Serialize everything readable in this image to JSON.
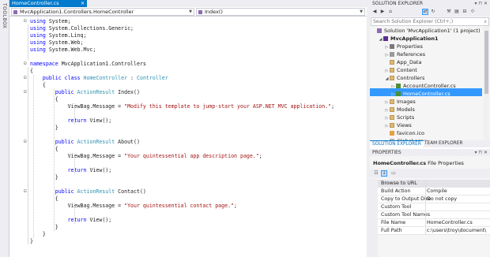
{
  "toolbox": {
    "label": "TOOLBOX"
  },
  "editor": {
    "tab_title": "HomeController.cs",
    "tab_close": "✕",
    "nav_class": "MvcApplication1.Controllers.HomeController",
    "nav_member": "Index()"
  },
  "code": {
    "lines": [
      [
        [
          "using ",
          "kw"
        ],
        [
          "System;",
          ""
        ]
      ],
      [
        [
          "using ",
          "kw"
        ],
        [
          "System.Collections.Generic;",
          ""
        ]
      ],
      [
        [
          "using ",
          "kw"
        ],
        [
          "System.Linq;",
          ""
        ]
      ],
      [
        [
          "using ",
          "kw"
        ],
        [
          "System.Web;",
          ""
        ]
      ],
      [
        [
          "using ",
          "kw"
        ],
        [
          "System.Web.Mvc;",
          ""
        ]
      ],
      [],
      [
        [
          "namespace ",
          "kw"
        ],
        [
          "MvcApplication1.Controllers",
          ""
        ]
      ],
      [
        [
          "{",
          ""
        ]
      ],
      [
        [
          "    public class ",
          "kw"
        ],
        [
          "HomeController",
          "ty"
        ],
        [
          " : ",
          ""
        ],
        [
          "Controller",
          "ty"
        ]
      ],
      [
        [
          "    {",
          ""
        ]
      ],
      [
        [
          "        public ",
          "kw"
        ],
        [
          "ActionResult",
          "ty"
        ],
        [
          " Index()",
          ""
        ]
      ],
      [
        [
          "        {",
          ""
        ]
      ],
      [
        [
          "            ViewBag.Message = ",
          ""
        ],
        [
          "\"Modify this template to jump-start your ASP.NET MVC application.\"",
          "st"
        ],
        [
          ";",
          ""
        ]
      ],
      [],
      [
        [
          "            return ",
          "kw"
        ],
        [
          "View();",
          ""
        ]
      ],
      [
        [
          "        }",
          ""
        ]
      ],
      [],
      [
        [
          "        public ",
          "kw"
        ],
        [
          "ActionResult",
          "ty"
        ],
        [
          " About()",
          ""
        ]
      ],
      [
        [
          "        {",
          ""
        ]
      ],
      [
        [
          "            ViewBag.Message = ",
          ""
        ],
        [
          "\"Your quintessential app description page.\"",
          "st"
        ],
        [
          ";",
          ""
        ]
      ],
      [],
      [
        [
          "            return ",
          "kw"
        ],
        [
          "View();",
          ""
        ]
      ],
      [
        [
          "        }",
          ""
        ]
      ],
      [],
      [
        [
          "        public ",
          "kw"
        ],
        [
          "ActionResult",
          "ty"
        ],
        [
          " Contact()",
          ""
        ]
      ],
      [
        [
          "        {",
          ""
        ]
      ],
      [
        [
          "            ViewBag.Message = ",
          ""
        ],
        [
          "\"Your quintessential contact page.\"",
          "st"
        ],
        [
          ";",
          ""
        ]
      ],
      [],
      [
        [
          "            return ",
          "kw"
        ],
        [
          "View();",
          ""
        ]
      ],
      [
        [
          "        }",
          ""
        ]
      ],
      [
        [
          "    }",
          ""
        ]
      ],
      [
        [
          "}",
          ""
        ]
      ]
    ]
  },
  "solution_explorer": {
    "title": "SOLUTION EXPLORER",
    "title_buttons": "▾ ⊓ ✕",
    "search_placeholder": "Search Solution Explorer (Ctrl+;)",
    "search_icon": "⌕",
    "items": [
      {
        "label": "Solution 'MvcApplication1' (1 project)",
        "icon": "sln-ic",
        "arrow": "",
        "depth": 0
      },
      {
        "label": "MvcApplication1",
        "icon": "proj-ic",
        "arrow": "◢",
        "depth": 1,
        "bold": true
      },
      {
        "label": "Properties",
        "icon": "prop-ic",
        "arrow": "▷",
        "depth": 2
      },
      {
        "label": "References",
        "icon": "ref-ic",
        "arrow": "▷",
        "depth": 2
      },
      {
        "label": "App_Data",
        "icon": "fold-ic",
        "arrow": "",
        "depth": 2
      },
      {
        "label": "Content",
        "icon": "fold-ic",
        "arrow": "▷",
        "depth": 2
      },
      {
        "label": "Controllers",
        "icon": "fold-ic",
        "arrow": "◢",
        "depth": 2
      },
      {
        "label": "AccountController.cs",
        "icon": "cs-ic",
        "arrow": "▷",
        "depth": 3
      },
      {
        "label": "HomeController.cs",
        "icon": "cs-ic",
        "arrow": "▷",
        "depth": 3,
        "selected": true
      },
      {
        "label": "Images",
        "icon": "fold-ic",
        "arrow": "▷",
        "depth": 2
      },
      {
        "label": "Models",
        "icon": "fold-ic",
        "arrow": "▷",
        "depth": 2
      },
      {
        "label": "Scripts",
        "icon": "fold-ic",
        "arrow": "▷",
        "depth": 2
      },
      {
        "label": "Views",
        "icon": "fold-ic",
        "arrow": "▷",
        "depth": 2
      },
      {
        "label": "favicon.ico",
        "icon": "fav-ic",
        "arrow": "",
        "depth": 2
      },
      {
        "label": "Global.asax",
        "icon": "gen-ic",
        "arrow": "▷",
        "depth": 2
      }
    ],
    "tabs": {
      "active": "SOLUTION EXPLORER",
      "other": "TEAM EXPLORER"
    }
  },
  "properties": {
    "title": "PROPERTIES",
    "title_buttons": "▾ ⊓ ✕",
    "object_name": "HomeController.cs",
    "object_type": "File Properties",
    "rows": [
      {
        "key": "Browse to URL",
        "value": ""
      },
      {
        "key": "Build Action",
        "value": "Compile"
      },
      {
        "key": "Copy to Output Dire",
        "value": "Do not copy"
      },
      {
        "key": "Custom Tool",
        "value": ""
      },
      {
        "key": "Custom Tool Names",
        "value": ""
      },
      {
        "key": "File Name",
        "value": "HomeController.cs"
      },
      {
        "key": "Full Path",
        "value": "c:\\users\\troy\\document\\"
      }
    ]
  },
  "colors": {
    "accent": "#007acc",
    "selection": "#3399ff",
    "keyword": "#0000ff",
    "type": "#2b91af",
    "string": "#a31515"
  }
}
